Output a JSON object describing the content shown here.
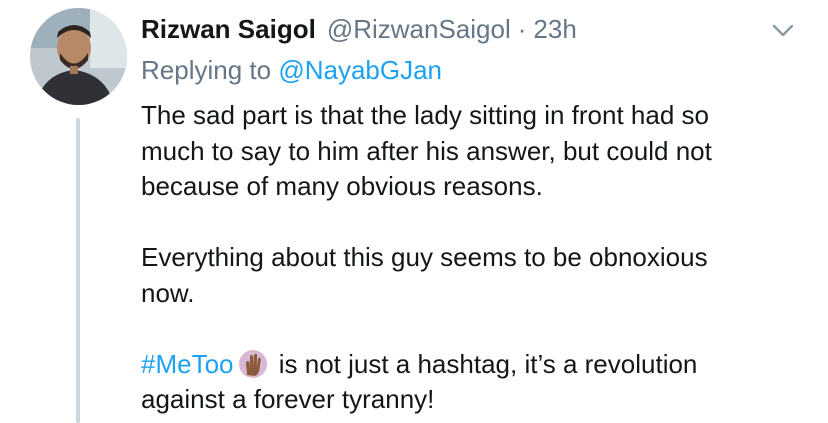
{
  "tweet": {
    "display_name": "Rizwan Saigol",
    "handle": "@RizwanSaigol",
    "separator": "·",
    "time": "23h",
    "replying_prefix": "Replying to",
    "replying_to": "@NayabGJan",
    "paragraph1_line1": "The sad part is that the lady sitting in front had so",
    "paragraph1_line2": "much to say to him after his answer, but could not",
    "paragraph1_line3": "because of many obvious reasons.",
    "paragraph2_line1": "Everything about this guy seems to be obnoxious",
    "paragraph2_line2": "now.",
    "hashtag": "#MeToo",
    "emoji_icon": "raised-hand-icon",
    "paragraph3_line1_rest": "is not just a hashtag, it’s a revolution",
    "paragraph3_line2": "against a forever tyranny!"
  },
  "colors": {
    "link": "#1da1f2",
    "secondary_text": "#657786",
    "primary_text": "#14171a",
    "thread_line": "#cdd6dd"
  }
}
